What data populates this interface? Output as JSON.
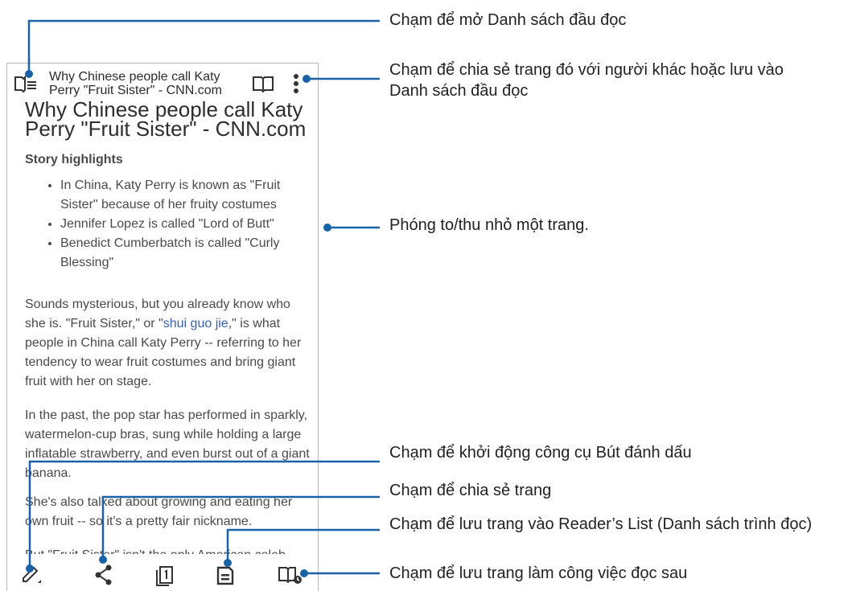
{
  "phone": {
    "header": {
      "title_line1": "Why Chinese people call Katy",
      "title_line2": "Perry \"Fruit Sister\" - CNN.com",
      "icons": [
        "reading-list-icon",
        "book-icon",
        "more-vert-icon"
      ]
    },
    "article": {
      "ghost_title": "Why Chinese people call Katy",
      "title": "Perry \"Fruit Sister\" - CNN.com",
      "highlights_heading": "Story highlights",
      "bullets": [
        "In China, Katy Perry is known as \"Fruit Sister\" because of her fruity costumes",
        "Jennifer Lopez is called \"Lord of Butt\"",
        "Benedict Cumberbatch is called \"Curly Blessing\""
      ],
      "p1_before": "Sounds mysterious, but you already know who she is. \"Fruit Sister,\" or \"",
      "p1_link": "shui guo jie",
      "p1_after": ",\" is what people in China call Katy Perry -- referring to her tendency to wear fruit costumes and bring giant fruit with her on stage.",
      "p2": "In the past, the pop star has performed in sparkly, watermelon-cup bras, sung while holding a large inflatable strawberry, and even burst out of a giant banana.",
      "p3": "She's also talked about growing and eating her own fruit -- so it's a pretty fair nickname.",
      "p4": "But \"Fruit Sister\" isn't the only American celeb"
    },
    "toolbar": {
      "icons": [
        "pen-icon",
        "share-icon",
        "page-icon",
        "save-icon",
        "read-later-icon"
      ]
    }
  },
  "callouts": {
    "open_list": "Chạm để mở Danh sách đầu đọc",
    "share_line1": "Chạm để chia sẻ trang đó với người khác hoặc lưu vào",
    "share_line2": "Danh sách đầu đọc",
    "zoom": "Phóng to/thu nhỏ một trang.",
    "marker": "Chạm để khởi động công cụ Bút đánh dấu",
    "share_page": "Chạm để chia sẻ trang",
    "save_list": "Chạm để lưu trang vào Reader’s List (Danh sách trình đọc)",
    "read_later": "Chạm để lưu trang làm công việc đọc sau"
  },
  "colors": {
    "accent_line": "#1a62a8",
    "text": "#222222",
    "link": "#3860b5"
  }
}
